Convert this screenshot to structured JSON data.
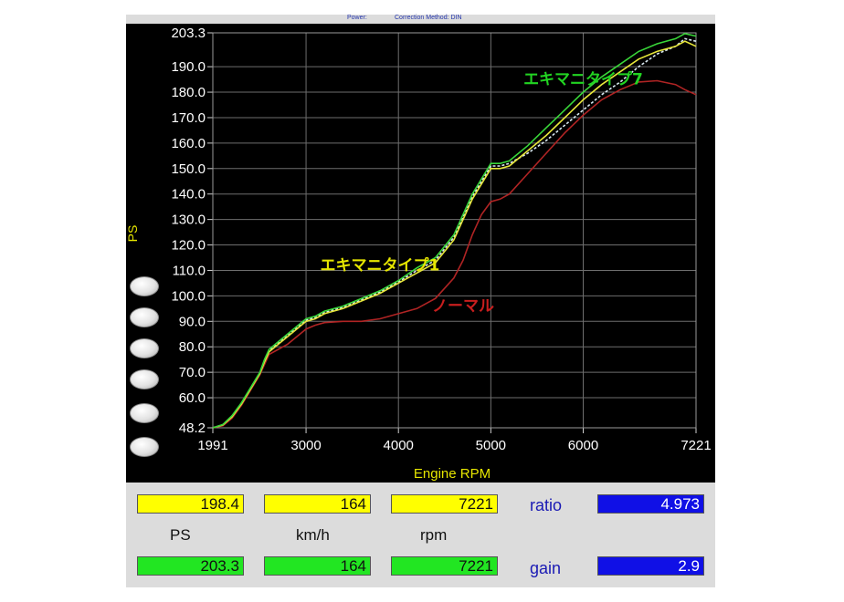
{
  "header": {
    "left": "Power:",
    "right": "Correction Method: DIN"
  },
  "chart_data": {
    "type": "line",
    "xlabel": "Engine RPM",
    "ylabel": "PS",
    "xlim": [
      1991,
      7221
    ],
    "ylim": [
      48.2,
      203.3
    ],
    "x_ticks": [
      1991,
      3000,
      4000,
      5000,
      6000,
      7221
    ],
    "y_ticks": [
      48.2,
      60.0,
      70.0,
      80.0,
      90.0,
      100.0,
      110.0,
      120.0,
      130.0,
      140.0,
      150.0,
      160.0,
      170.0,
      180.0,
      190.0,
      203.3
    ],
    "grid": true,
    "annotations": [
      {
        "text": "エキマニタイプ7",
        "x": 6000,
        "y": 183,
        "color": "#22d422"
      },
      {
        "text": "エキマニタイプ1",
        "x": 3800,
        "y": 110,
        "color": "#e6e600"
      },
      {
        "text": "ノーマル",
        "x": 4700,
        "y": 94,
        "color": "#c81e1e"
      }
    ],
    "series": [
      {
        "name": "エキマニタイプ7",
        "color": "#39d639",
        "x": [
          1991,
          2100,
          2200,
          2300,
          2400,
          2500,
          2550,
          2600,
          2700,
          2800,
          2900,
          3000,
          3100,
          3200,
          3400,
          3600,
          3800,
          4000,
          4200,
          4400,
          4600,
          4700,
          4800,
          4900,
          5000,
          5100,
          5200,
          5400,
          5600,
          5800,
          6000,
          6200,
          6400,
          6600,
          6800,
          7000,
          7100,
          7221
        ],
        "y": [
          48.2,
          49.5,
          53,
          58,
          64,
          70,
          75,
          79,
          82,
          85,
          88,
          91,
          92,
          94,
          96,
          99,
          102,
          106,
          111,
          115,
          124,
          132,
          140,
          146,
          152,
          152,
          153,
          159,
          166,
          173,
          180,
          186,
          191,
          196,
          199,
          201,
          203,
          202
        ]
      },
      {
        "name": "エキマニタイプ1",
        "color": "#e6e63a",
        "x": [
          1991,
          2100,
          2200,
          2300,
          2400,
          2500,
          2550,
          2600,
          2700,
          2800,
          2900,
          3000,
          3100,
          3200,
          3400,
          3600,
          3800,
          4000,
          4200,
          4400,
          4600,
          4700,
          4800,
          4900,
          5000,
          5100,
          5200,
          5400,
          5600,
          5800,
          6000,
          6200,
          6400,
          6600,
          6800,
          7000,
          7100,
          7221
        ],
        "y": [
          48.2,
          49.3,
          52.5,
          57.5,
          63.5,
          69.5,
          74,
          78,
          81,
          84,
          87,
          90,
          91,
          93,
          95,
          98,
          101,
          105,
          109,
          113,
          122,
          130,
          138,
          144,
          150,
          150,
          151,
          157,
          163,
          170,
          177,
          183,
          188,
          193,
          196,
          198,
          200,
          198
        ]
      },
      {
        "name": "series-white",
        "color": "#d8e8f0",
        "x": [
          1991,
          2100,
          2200,
          2300,
          2400,
          2500,
          2550,
          2600,
          2700,
          2800,
          2900,
          3000,
          3100,
          3200,
          3400,
          3600,
          3800,
          4000,
          4200,
          4400,
          4600,
          4700,
          4800,
          4900,
          5000,
          5100,
          5200,
          5400,
          5600,
          5800,
          6000,
          6200,
          6400,
          6600,
          6800,
          7000,
          7100,
          7221
        ],
        "y": [
          48.2,
          49.4,
          52.8,
          57.8,
          63.8,
          69.8,
          74.5,
          78.5,
          81.5,
          84.5,
          87.5,
          90.5,
          91.5,
          93.5,
          95.5,
          98.5,
          101.5,
          105.5,
          110,
          114,
          123,
          131,
          139,
          145,
          151,
          151,
          152,
          156,
          161,
          167,
          173,
          179,
          184,
          190,
          195,
          198,
          201,
          200
        ]
      },
      {
        "name": "ノーマル",
        "color": "#b02424",
        "x": [
          1991,
          2100,
          2200,
          2300,
          2400,
          2500,
          2550,
          2600,
          2700,
          2800,
          2900,
          3000,
          3100,
          3200,
          3400,
          3600,
          3800,
          4000,
          4200,
          4400,
          4600,
          4700,
          4800,
          4900,
          5000,
          5100,
          5200,
          5400,
          5600,
          5800,
          6000,
          6200,
          6400,
          6600,
          6800,
          7000,
          7100,
          7221
        ],
        "y": [
          48.2,
          49,
          52,
          57,
          63,
          69,
          73,
          77,
          79,
          81,
          84,
          87,
          88.5,
          89.5,
          90,
          90,
          91,
          93,
          95,
          99,
          107,
          114,
          124,
          132,
          137,
          138,
          140,
          148,
          156,
          164,
          171,
          177,
          181,
          184,
          184.5,
          183,
          181,
          179
        ]
      }
    ]
  },
  "readouts": {
    "row1": [
      "198.4",
      "164",
      "7221"
    ],
    "units": [
      "PS",
      "km/h",
      "rpm"
    ],
    "row2": [
      "203.3",
      "164",
      "7221"
    ],
    "ratio_label": "ratio",
    "ratio_value": "4.973",
    "gain_label": "gain",
    "gain_value": "2.9"
  }
}
